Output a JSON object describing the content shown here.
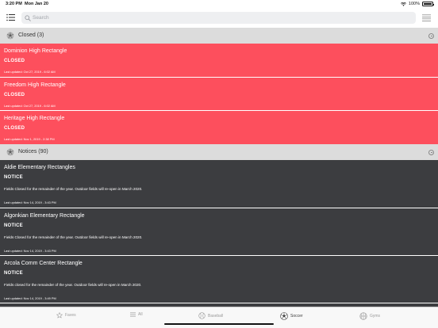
{
  "status_bar": {
    "time": "3:20 PM",
    "date": "Mon Jan 20",
    "battery": "100%"
  },
  "search": {
    "placeholder": "Search",
    "value": ""
  },
  "sections": {
    "closed": {
      "title": "Closed (3)"
    },
    "notices": {
      "title": "Notices (90)"
    }
  },
  "closed_rows": [
    {
      "title": "Dominion High Rectangle",
      "status": "CLOSED",
      "updated": "Last updated: Oct 27, 2019 - 6:02 AM"
    },
    {
      "title": "Freedom High Rectangle",
      "status": "CLOSED",
      "updated": "Last updated: Oct 27, 2019 - 6:02 AM"
    },
    {
      "title": "Heritage High Rectangle",
      "status": "CLOSED",
      "updated": "Last updated: Nov 1, 2019 - 2:38 PM"
    }
  ],
  "notice_rows": [
    {
      "title": "Aldie Elementary Rectangles",
      "status": "NOTICE",
      "description": "Fields Closed for the remainder of the year. Outdoor fields will re-open in March 2020.",
      "updated": "Last updated: Nov 14, 2019 - 3:43 PM"
    },
    {
      "title": "Algonkian Elementary Rectangle",
      "status": "NOTICE",
      "description": "Fields Closed for the remainder of the year. Outdoor fields will re-open in March 2020.",
      "updated": "Last updated: Nov 14, 2019 - 3:43 PM"
    },
    {
      "title": "Arcola Comm Center Rectangle",
      "status": "NOTICE",
      "description": "Fields closed for the remainder of the year. Outdoor fields will re-open in March 2020.",
      "updated": "Last updated: Nov 14, 2019 - 3:49 PM"
    }
  ],
  "tabs": [
    {
      "label": "Faves",
      "icon": "star-icon",
      "active": false
    },
    {
      "label": "All",
      "icon": "list-icon",
      "active": false
    },
    {
      "label": "Baseball",
      "icon": "baseball-icon",
      "active": false
    },
    {
      "label": "Soccer",
      "icon": "soccer-ball-icon",
      "active": true
    },
    {
      "label": "Gyms",
      "icon": "basketball-icon",
      "active": false
    }
  ],
  "colors": {
    "closed": "#fd4f5d",
    "notice": "#3c3d40",
    "section_header": "#dcdcdc",
    "accent": "#3a3a3a"
  }
}
